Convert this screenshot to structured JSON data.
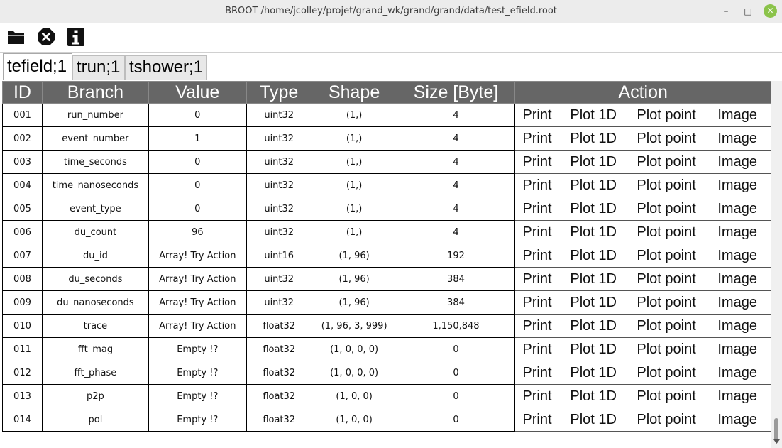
{
  "window": {
    "title": "BROOT /home/jcolley/projet/grand_wk/grand/grand/data/test_efield.root",
    "min_glyph": "–",
    "max_glyph": "□",
    "close_glyph": "✕"
  },
  "toolbar": {
    "icons": [
      "folder-open-icon",
      "close-file-icon",
      "info-icon"
    ]
  },
  "tabs": [
    "tefield;1",
    "trun;1",
    "tshower;1"
  ],
  "table": {
    "headers": [
      "ID",
      "Branch",
      "Value",
      "Type",
      "Shape",
      "Size [Byte]",
      "Action"
    ],
    "action_labels": [
      "Print",
      "Plot 1D",
      "Plot point",
      "Image"
    ],
    "rows": [
      {
        "id": "001",
        "branch": "run_number",
        "value": "0",
        "type": "uint32",
        "shape": "(1,)",
        "size": "4"
      },
      {
        "id": "002",
        "branch": "event_number",
        "value": "1",
        "type": "uint32",
        "shape": "(1,)",
        "size": "4"
      },
      {
        "id": "003",
        "branch": "time_seconds",
        "value": "0",
        "type": "uint32",
        "shape": "(1,)",
        "size": "4"
      },
      {
        "id": "004",
        "branch": "time_nanoseconds",
        "value": "0",
        "type": "uint32",
        "shape": "(1,)",
        "size": "4"
      },
      {
        "id": "005",
        "branch": "event_type",
        "value": "0",
        "type": "uint32",
        "shape": "(1,)",
        "size": "4"
      },
      {
        "id": "006",
        "branch": "du_count",
        "value": "96",
        "type": "uint32",
        "shape": "(1,)",
        "size": "4"
      },
      {
        "id": "007",
        "branch": "du_id",
        "value": "Array! Try Action",
        "type": "uint16",
        "shape": "(1, 96)",
        "size": "192"
      },
      {
        "id": "008",
        "branch": "du_seconds",
        "value": "Array! Try Action",
        "type": "uint32",
        "shape": "(1, 96)",
        "size": "384"
      },
      {
        "id": "009",
        "branch": "du_nanoseconds",
        "value": "Array! Try Action",
        "type": "uint32",
        "shape": "(1, 96)",
        "size": "384"
      },
      {
        "id": "010",
        "branch": "trace",
        "value": "Array! Try Action",
        "type": "float32",
        "shape": "(1, 96, 3, 999)",
        "size": "1,150,848"
      },
      {
        "id": "011",
        "branch": "fft_mag",
        "value": "Empty !?",
        "type": "float32",
        "shape": "(1, 0, 0, 0)",
        "size": "0"
      },
      {
        "id": "012",
        "branch": "fft_phase",
        "value": "Empty !?",
        "type": "float32",
        "shape": "(1, 0, 0, 0)",
        "size": "0"
      },
      {
        "id": "013",
        "branch": "p2p",
        "value": "Empty !?",
        "type": "float32",
        "shape": "(1, 0, 0)",
        "size": "0"
      },
      {
        "id": "014",
        "branch": "pol",
        "value": "Empty !?",
        "type": "float32",
        "shape": "(1, 0, 0)",
        "size": "0"
      }
    ]
  }
}
